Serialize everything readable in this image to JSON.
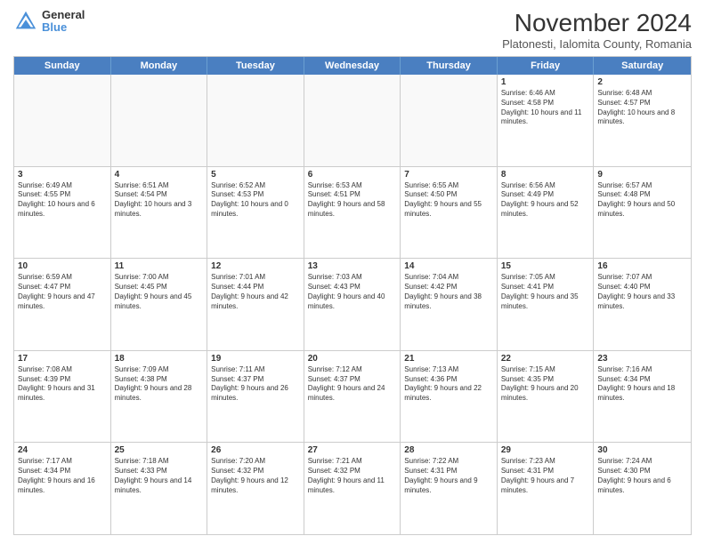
{
  "header": {
    "logo_general": "General",
    "logo_blue": "Blue",
    "title": "November 2024",
    "subtitle": "Platonesti, Ialomita County, Romania"
  },
  "days_of_week": [
    "Sunday",
    "Monday",
    "Tuesday",
    "Wednesday",
    "Thursday",
    "Friday",
    "Saturday"
  ],
  "rows": [
    [
      {
        "day": "",
        "info": ""
      },
      {
        "day": "",
        "info": ""
      },
      {
        "day": "",
        "info": ""
      },
      {
        "day": "",
        "info": ""
      },
      {
        "day": "",
        "info": ""
      },
      {
        "day": "1",
        "info": "Sunrise: 6:46 AM\nSunset: 4:58 PM\nDaylight: 10 hours and 11 minutes."
      },
      {
        "day": "2",
        "info": "Sunrise: 6:48 AM\nSunset: 4:57 PM\nDaylight: 10 hours and 8 minutes."
      }
    ],
    [
      {
        "day": "3",
        "info": "Sunrise: 6:49 AM\nSunset: 4:55 PM\nDaylight: 10 hours and 6 minutes."
      },
      {
        "day": "4",
        "info": "Sunrise: 6:51 AM\nSunset: 4:54 PM\nDaylight: 10 hours and 3 minutes."
      },
      {
        "day": "5",
        "info": "Sunrise: 6:52 AM\nSunset: 4:53 PM\nDaylight: 10 hours and 0 minutes."
      },
      {
        "day": "6",
        "info": "Sunrise: 6:53 AM\nSunset: 4:51 PM\nDaylight: 9 hours and 58 minutes."
      },
      {
        "day": "7",
        "info": "Sunrise: 6:55 AM\nSunset: 4:50 PM\nDaylight: 9 hours and 55 minutes."
      },
      {
        "day": "8",
        "info": "Sunrise: 6:56 AM\nSunset: 4:49 PM\nDaylight: 9 hours and 52 minutes."
      },
      {
        "day": "9",
        "info": "Sunrise: 6:57 AM\nSunset: 4:48 PM\nDaylight: 9 hours and 50 minutes."
      }
    ],
    [
      {
        "day": "10",
        "info": "Sunrise: 6:59 AM\nSunset: 4:47 PM\nDaylight: 9 hours and 47 minutes."
      },
      {
        "day": "11",
        "info": "Sunrise: 7:00 AM\nSunset: 4:45 PM\nDaylight: 9 hours and 45 minutes."
      },
      {
        "day": "12",
        "info": "Sunrise: 7:01 AM\nSunset: 4:44 PM\nDaylight: 9 hours and 42 minutes."
      },
      {
        "day": "13",
        "info": "Sunrise: 7:03 AM\nSunset: 4:43 PM\nDaylight: 9 hours and 40 minutes."
      },
      {
        "day": "14",
        "info": "Sunrise: 7:04 AM\nSunset: 4:42 PM\nDaylight: 9 hours and 38 minutes."
      },
      {
        "day": "15",
        "info": "Sunrise: 7:05 AM\nSunset: 4:41 PM\nDaylight: 9 hours and 35 minutes."
      },
      {
        "day": "16",
        "info": "Sunrise: 7:07 AM\nSunset: 4:40 PM\nDaylight: 9 hours and 33 minutes."
      }
    ],
    [
      {
        "day": "17",
        "info": "Sunrise: 7:08 AM\nSunset: 4:39 PM\nDaylight: 9 hours and 31 minutes."
      },
      {
        "day": "18",
        "info": "Sunrise: 7:09 AM\nSunset: 4:38 PM\nDaylight: 9 hours and 28 minutes."
      },
      {
        "day": "19",
        "info": "Sunrise: 7:11 AM\nSunset: 4:37 PM\nDaylight: 9 hours and 26 minutes."
      },
      {
        "day": "20",
        "info": "Sunrise: 7:12 AM\nSunset: 4:37 PM\nDaylight: 9 hours and 24 minutes."
      },
      {
        "day": "21",
        "info": "Sunrise: 7:13 AM\nSunset: 4:36 PM\nDaylight: 9 hours and 22 minutes."
      },
      {
        "day": "22",
        "info": "Sunrise: 7:15 AM\nSunset: 4:35 PM\nDaylight: 9 hours and 20 minutes."
      },
      {
        "day": "23",
        "info": "Sunrise: 7:16 AM\nSunset: 4:34 PM\nDaylight: 9 hours and 18 minutes."
      }
    ],
    [
      {
        "day": "24",
        "info": "Sunrise: 7:17 AM\nSunset: 4:34 PM\nDaylight: 9 hours and 16 minutes."
      },
      {
        "day": "25",
        "info": "Sunrise: 7:18 AM\nSunset: 4:33 PM\nDaylight: 9 hours and 14 minutes."
      },
      {
        "day": "26",
        "info": "Sunrise: 7:20 AM\nSunset: 4:32 PM\nDaylight: 9 hours and 12 minutes."
      },
      {
        "day": "27",
        "info": "Sunrise: 7:21 AM\nSunset: 4:32 PM\nDaylight: 9 hours and 11 minutes."
      },
      {
        "day": "28",
        "info": "Sunrise: 7:22 AM\nSunset: 4:31 PM\nDaylight: 9 hours and 9 minutes."
      },
      {
        "day": "29",
        "info": "Sunrise: 7:23 AM\nSunset: 4:31 PM\nDaylight: 9 hours and 7 minutes."
      },
      {
        "day": "30",
        "info": "Sunrise: 7:24 AM\nSunset: 4:30 PM\nDaylight: 9 hours and 6 minutes."
      }
    ]
  ]
}
